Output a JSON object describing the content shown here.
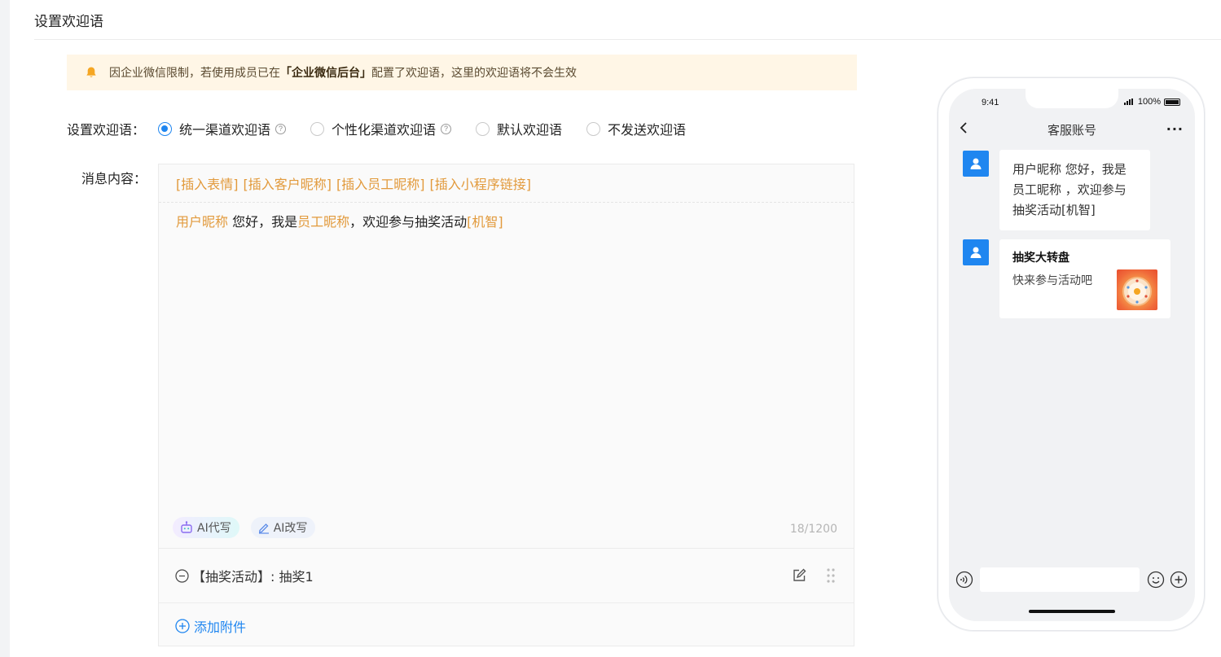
{
  "page": {
    "title": "设置欢迎语"
  },
  "notice": {
    "prefix": "因企业微信限制，若使用成员已在",
    "highlight": "「企业微信后台」",
    "suffix": "配置了欢迎语，这里的欢迎语将不会生效"
  },
  "welcome_setting": {
    "label": "设置欢迎语：",
    "options": [
      {
        "label": "统一渠道欢迎语",
        "checked": true,
        "help": true
      },
      {
        "label": "个性化渠道欢迎语",
        "checked": false,
        "help": true
      },
      {
        "label": "默认欢迎语",
        "checked": false,
        "help": false
      },
      {
        "label": "不发送欢迎语",
        "checked": false,
        "help": false
      }
    ]
  },
  "message": {
    "label": "消息内容：",
    "toolbar": [
      "[插入表情]",
      "[插入客户昵称]",
      "[插入员工昵称]",
      "[插入小程序链接]"
    ],
    "content": {
      "var1": "用户昵称",
      "text1": " 您好，我是",
      "var2": "员工昵称",
      "text2": "，欢迎参与抽奖活动",
      "var3": "[机智]"
    },
    "ai_write": "AI代写",
    "ai_rewrite": "AI改写",
    "counter": "18/1200",
    "attachment": "【抽奖活动】: 抽奖1",
    "add_attachment": "添加附件"
  },
  "phone": {
    "time": "9:41",
    "battery": "100%",
    "title": "客服账号",
    "more": "···",
    "bubble_text": " 用户昵称  您好，我是 员工昵称 ，欢迎参与抽奖活动[机智]",
    "card_title": "抽奖大转盘",
    "card_desc": "快来参与活动吧"
  },
  "colors": {
    "accent": "#1f86f0",
    "variable": "#e29a3c",
    "notice_bg": "#fff6e6"
  }
}
